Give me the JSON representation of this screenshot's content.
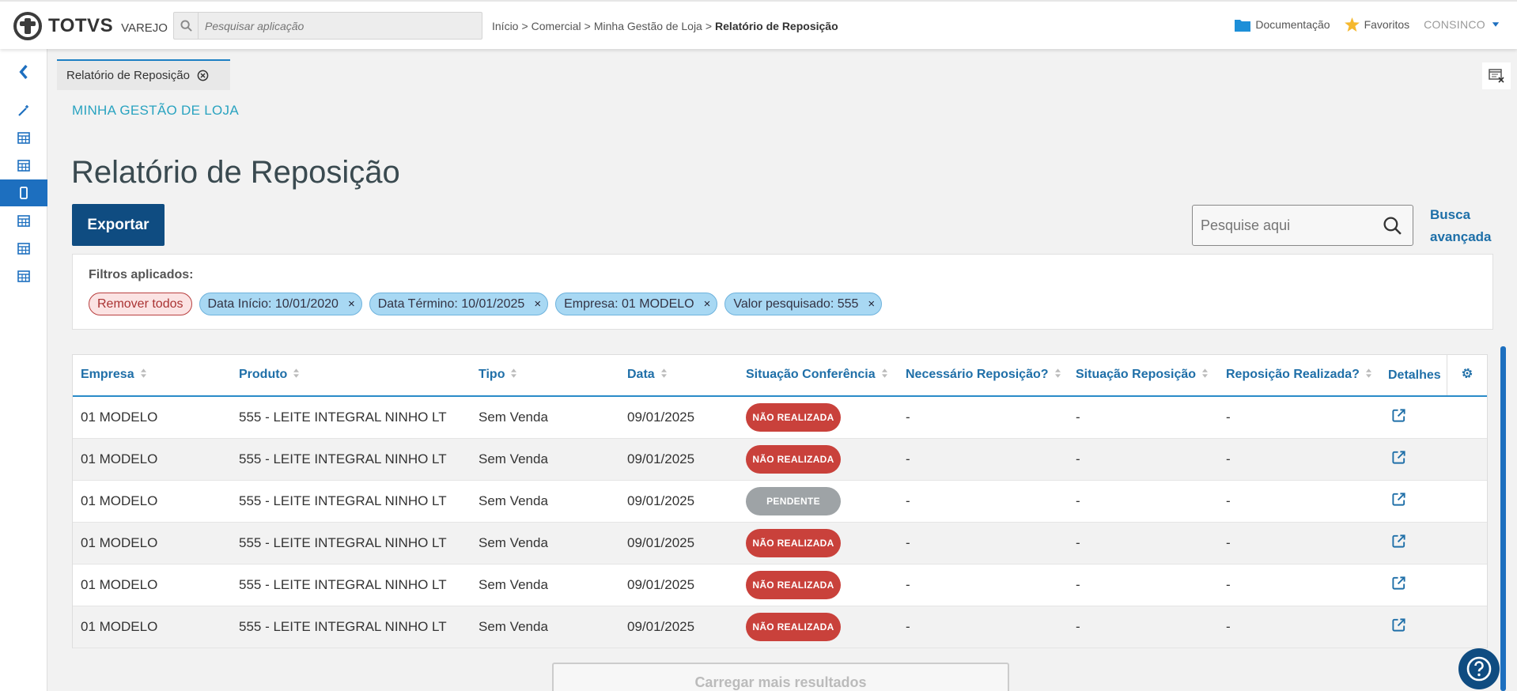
{
  "brand": {
    "name": "TOTVS",
    "product": "VAREJO"
  },
  "search_app": {
    "placeholder": "Pesquisar aplicação"
  },
  "breadcrumb": {
    "items": [
      "Início",
      "Comercial",
      "Minha Gestão de Loja"
    ],
    "separator": ">",
    "current": "Relatório de Reposição"
  },
  "top_links": {
    "documentation": "Documentação",
    "favorites": "Favoritos",
    "user": "CONSINCO"
  },
  "tab": {
    "label": "Relatório de Reposição"
  },
  "module_label": "MINHA GESTÃO DE LOJA",
  "page_title": "Relatório de Reposição",
  "export_label": "Exportar",
  "search": {
    "placeholder": "Pesquise aqui"
  },
  "advanced_search": "Busca avançada",
  "filters": {
    "title": "Filtros aplicados:",
    "remove_all": "Remover todos",
    "chips": [
      "Data Início: 10/01/2020",
      "Data Término: 10/01/2025",
      "Empresa: 01 MODELO",
      "Valor pesquisado: 555"
    ],
    "close_glyph": "×"
  },
  "table": {
    "columns": [
      "Empresa",
      "Produto",
      "Tipo",
      "Data",
      "Situação Conferência",
      "Necessário Reposição?",
      "Situação Reposição",
      "Reposição Realizada?",
      "Detalhes"
    ],
    "rows": [
      {
        "empresa": "01 MODELO",
        "produto": "555 - LEITE INTEGRAL NINHO LT",
        "tipo": "Sem Venda",
        "data": "09/01/2025",
        "situacao": "NÃO REALIZADA",
        "necessario": "-",
        "sit_reposicao": "-",
        "realizada": "-"
      },
      {
        "empresa": "01 MODELO",
        "produto": "555 - LEITE INTEGRAL NINHO LT",
        "tipo": "Sem Venda",
        "data": "09/01/2025",
        "situacao": "NÃO REALIZADA",
        "necessario": "-",
        "sit_reposicao": "-",
        "realizada": "-"
      },
      {
        "empresa": "01 MODELO",
        "produto": "555 - LEITE INTEGRAL NINHO LT",
        "tipo": "Sem Venda",
        "data": "09/01/2025",
        "situacao": "PENDENTE",
        "necessario": "-",
        "sit_reposicao": "-",
        "realizada": "-"
      },
      {
        "empresa": "01 MODELO",
        "produto": "555 - LEITE INTEGRAL NINHO LT",
        "tipo": "Sem Venda",
        "data": "09/01/2025",
        "situacao": "NÃO REALIZADA",
        "necessario": "-",
        "sit_reposicao": "-",
        "realizada": "-"
      },
      {
        "empresa": "01 MODELO",
        "produto": "555 - LEITE INTEGRAL NINHO LT",
        "tipo": "Sem Venda",
        "data": "09/01/2025",
        "situacao": "NÃO REALIZADA",
        "necessario": "-",
        "sit_reposicao": "-",
        "realizada": "-"
      },
      {
        "empresa": "01 MODELO",
        "produto": "555 - LEITE INTEGRAL NINHO LT",
        "tipo": "Sem Venda",
        "data": "09/01/2025",
        "situacao": "NÃO REALIZADA",
        "necessario": "-",
        "sit_reposicao": "-",
        "realizada": "-"
      }
    ]
  },
  "load_more": "Carregar mais resultados",
  "colors": {
    "primary": "#0f4c81",
    "accent": "#1d6fbf",
    "header_text": "#1f6fa8",
    "module_teal": "#29a3c0",
    "status_red": "#c9413b",
    "status_gray": "#9ea3a6",
    "chip_blue": "#a8d8f3",
    "favorite_star": "#f5b82e"
  },
  "icons": {
    "search_app": "search-icon",
    "documentation": "folder-icon",
    "favorites": "star-icon",
    "user_menu": "caret-down-icon",
    "sidebar": [
      "chevron-left-icon",
      "magic-wand-icon",
      "table-icon",
      "table-icon",
      "mobile-icon",
      "table-icon",
      "table-icon",
      "table-icon"
    ],
    "tab_close": "close-circle-icon",
    "tab_tools": "window-close-icon",
    "search": "search-icon",
    "sort": "sort-icon",
    "settings": "gear-icon",
    "details": "external-link-icon",
    "help": "help-icon"
  }
}
